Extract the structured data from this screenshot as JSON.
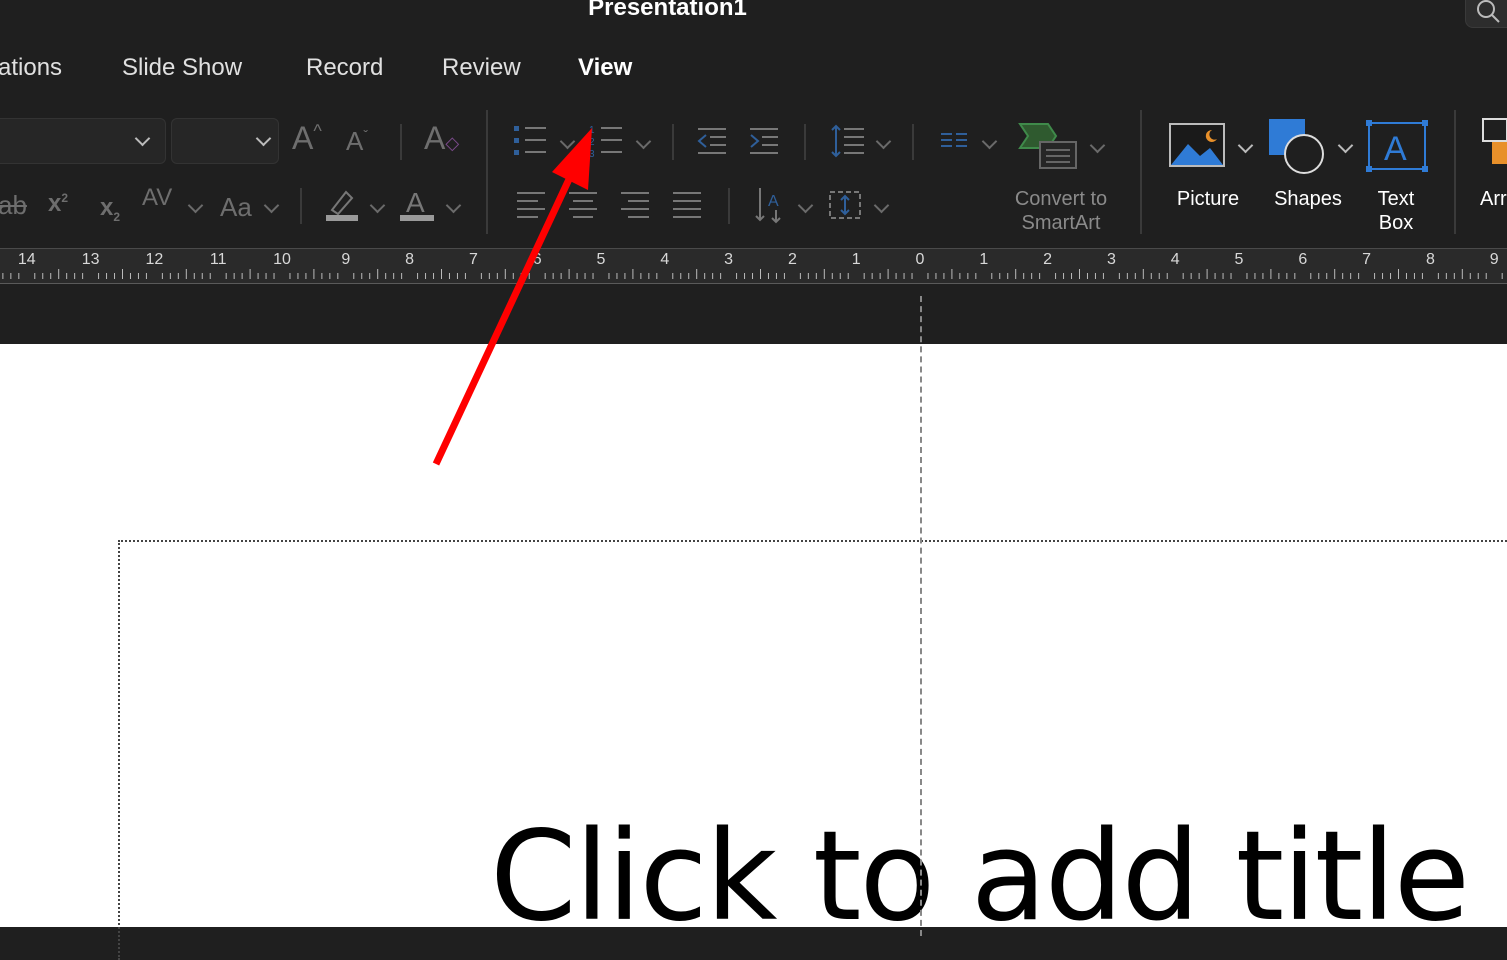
{
  "window": {
    "title": "Presentation1"
  },
  "tabs": [
    {
      "label": "ations"
    },
    {
      "label": "Slide Show"
    },
    {
      "label": "Record"
    },
    {
      "label": "Review"
    },
    {
      "label": "View"
    }
  ],
  "ribbon": {
    "font_name_value": "",
    "font_size_value": "",
    "convert_smartart": {
      "line1": "Convert to",
      "line2": "SmartArt"
    },
    "picture": {
      "label": "Picture"
    },
    "shapes": {
      "label": "Shapes"
    },
    "text_box": {
      "line1": "Text",
      "line2": "Box"
    },
    "arrange": {
      "label": "Arr"
    }
  },
  "ruler": {
    "labels": [
      "14",
      "13",
      "12",
      "11",
      "10",
      "9",
      "8",
      "7",
      "6",
      "5",
      "4",
      "3",
      "2",
      "1",
      "0",
      "1",
      "2",
      "3",
      "4",
      "5",
      "6",
      "7",
      "8",
      "9"
    ]
  },
  "slide": {
    "title_placeholder": "Click to add title"
  },
  "annotation": {
    "arrow_color": "#ff0000"
  },
  "colors": {
    "accent_blue": "#2f7bd6",
    "smartart_green": "#3f8a4a",
    "shape_orange": "#e8902a"
  }
}
